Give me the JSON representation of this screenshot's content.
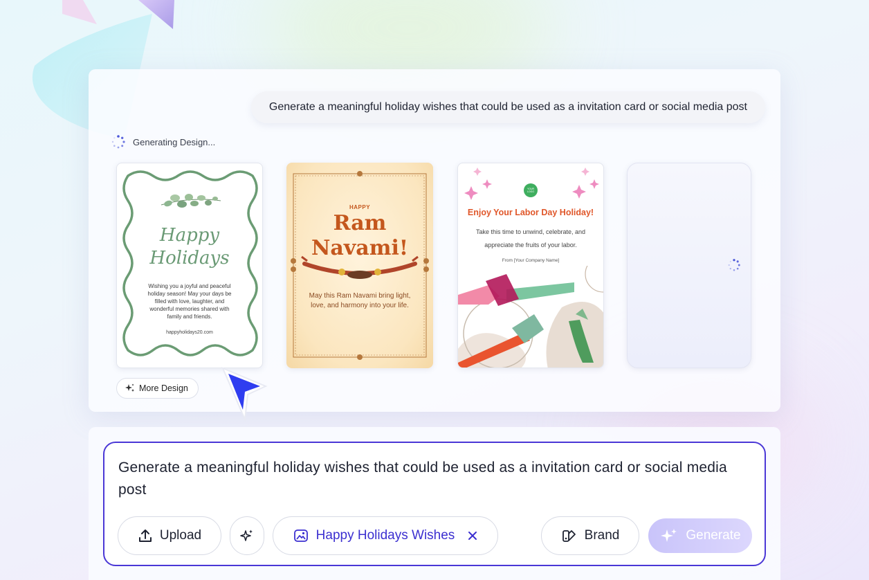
{
  "prompt_bubble_text": "Generate a meaningful holiday wishes that could be used as a invitation card or social media post",
  "status_text": "Generating Design...",
  "cards": {
    "holidays": {
      "title_line1": "Happy",
      "title_line2": "Holidays",
      "body": "Wishing you a joyful and peaceful holiday season! May your days be filled with love, laughter, and wonderful memories shared with family and friends.",
      "url": "happyholidays20.com"
    },
    "ram_navami": {
      "kicker": "HAPPY",
      "title_line1": "Ram",
      "title_line2": "Navami!",
      "body": "May this Ram Navami bring light, love, and harmony into your life."
    },
    "labor_day": {
      "logo": "YOUR LOGO",
      "title": "Enjoy Your Labor Day Holiday!",
      "body": "Take this time to unwind, celebrate, and appreciate the fruits of your labor.",
      "from": "From [Your Company Name]"
    }
  },
  "more_design_label": "More Design",
  "composer": {
    "text": "Generate a meaningful holiday wishes that could be used as a invitation card or social media post",
    "upload_label": "Upload",
    "template_chip_label": "Happy Holidays Wishes",
    "brand_label": "Brand",
    "generate_label": "Generate"
  },
  "colors": {
    "accent": "#4a37d6",
    "cursor": "#2f3df0",
    "generate_disabled": "#c9c4fa"
  }
}
